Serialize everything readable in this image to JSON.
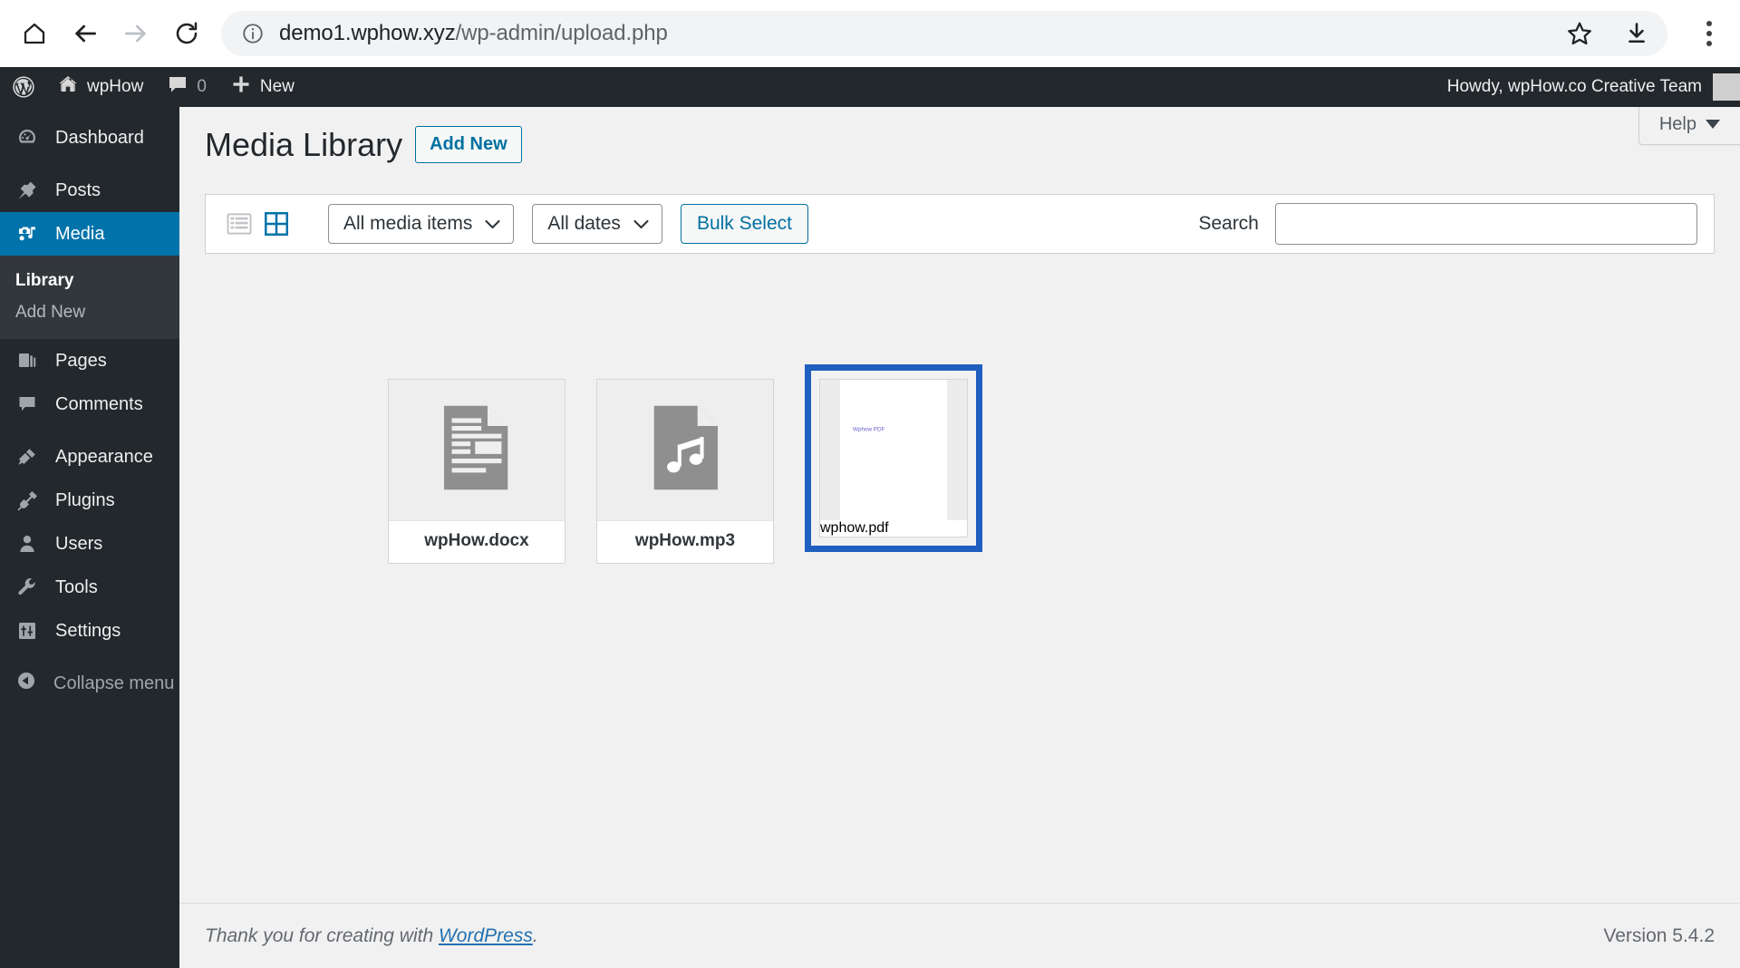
{
  "browser": {
    "url_bold": "demo1.wphow.xyz",
    "url_path": "/wp-admin/upload.php",
    "icons": {
      "home": "home-icon",
      "back": "back-arrow-icon",
      "forward": "forward-arrow-icon",
      "reload": "reload-icon",
      "info": "site-info-icon",
      "bookmark": "star-icon",
      "download": "download-icon",
      "menu": "kebab-menu-icon"
    }
  },
  "adminbar": {
    "logo": "wordpress-logo-icon",
    "site_name": "wpHow",
    "comment_count": "0",
    "new_label": "New",
    "howdy": "Howdy, wpHow.co Creative Team"
  },
  "sidebar": {
    "items": [
      {
        "label": "Dashboard",
        "icon": "dashboard-icon",
        "active": false
      },
      {
        "label": "Posts",
        "icon": "pin-icon",
        "active": false
      },
      {
        "label": "Media",
        "icon": "media-icon",
        "active": true
      },
      {
        "label": "Pages",
        "icon": "pages-icon",
        "active": false
      },
      {
        "label": "Comments",
        "icon": "comment-icon",
        "active": false
      },
      {
        "label": "Appearance",
        "icon": "paintbrush-icon",
        "active": false
      },
      {
        "label": "Plugins",
        "icon": "plug-icon",
        "active": false
      },
      {
        "label": "Users",
        "icon": "user-icon",
        "active": false
      },
      {
        "label": "Tools",
        "icon": "wrench-icon",
        "active": false
      },
      {
        "label": "Settings",
        "icon": "settings-sliders-icon",
        "active": false
      }
    ],
    "media_submenu": [
      {
        "label": "Library",
        "current": true
      },
      {
        "label": "Add New",
        "current": false
      }
    ],
    "collapse_label": "Collapse menu"
  },
  "page": {
    "title": "Media Library",
    "add_new_label": "Add New",
    "help_tab_label": "Help"
  },
  "toolbar": {
    "view_list_icon": "list-view-icon",
    "view_grid_icon": "grid-view-icon",
    "media_type_filter": "All media items",
    "date_filter": "All dates",
    "bulk_select_label": "Bulk Select",
    "search_label": "Search",
    "search_value": "",
    "search_placeholder": ""
  },
  "media": {
    "items": [
      {
        "filename": "wpHow.docx",
        "kind": "document",
        "selected": false
      },
      {
        "filename": "wpHow.mp3",
        "kind": "audio",
        "selected": false
      },
      {
        "filename": "wphow.pdf",
        "kind": "pdf",
        "selected": true,
        "preview_text": "Wphow PDF"
      }
    ]
  },
  "footer": {
    "thanks_prefix": "Thank you for creating with ",
    "wordpress_link": "WordPress",
    "thanks_suffix": ".",
    "version": "Version 5.4.2"
  },
  "colors": {
    "admin_dark": "#23282d",
    "submenu_dark": "#32373c",
    "accent_blue": "#0073aa",
    "link_blue": "#2271b1",
    "selection_blue": "#1f5fc0",
    "page_bg": "#f1f1f1"
  }
}
